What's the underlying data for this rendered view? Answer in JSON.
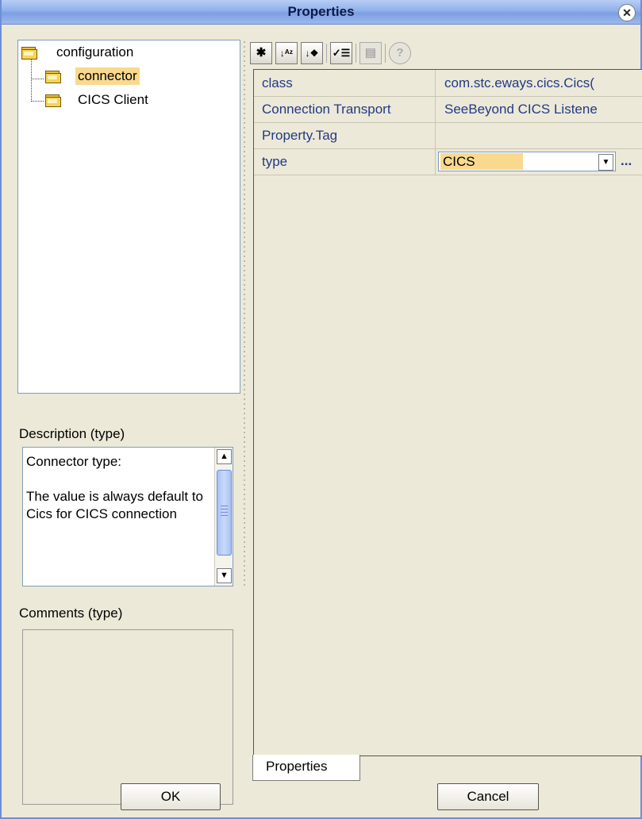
{
  "window": {
    "title": "Properties"
  },
  "tree": {
    "root": "configuration",
    "children": [
      "connector",
      "CICS Client"
    ],
    "selected": "connector"
  },
  "description": {
    "label": "Description (type)",
    "text": "Connector type:\n\nThe value is always default to Cics for CICS connection"
  },
  "comments": {
    "label": "Comments (type)",
    "text": ""
  },
  "toolbar": {
    "icons": [
      "expand-icon",
      "sort-alpha-icon",
      "sort-category-icon",
      "checklist-icon",
      "grid-icon",
      "help-icon"
    ]
  },
  "properties": {
    "rows": [
      {
        "name": "class",
        "value": "com.stc.eways.cics.Cics("
      },
      {
        "name": "Connection Transport",
        "value": "SeeBeyond CICS Listene"
      },
      {
        "name": "Property.Tag",
        "value": ""
      },
      {
        "name": "type",
        "value": "CICS"
      }
    ],
    "ellipsis": "..."
  },
  "tab": {
    "label": "Properties"
  },
  "buttons": {
    "ok": "OK",
    "cancel": "Cancel"
  },
  "colors": {
    "selection": "#f9d98e",
    "property_text": "#223a86",
    "title_bar": "#8fb0ea"
  }
}
